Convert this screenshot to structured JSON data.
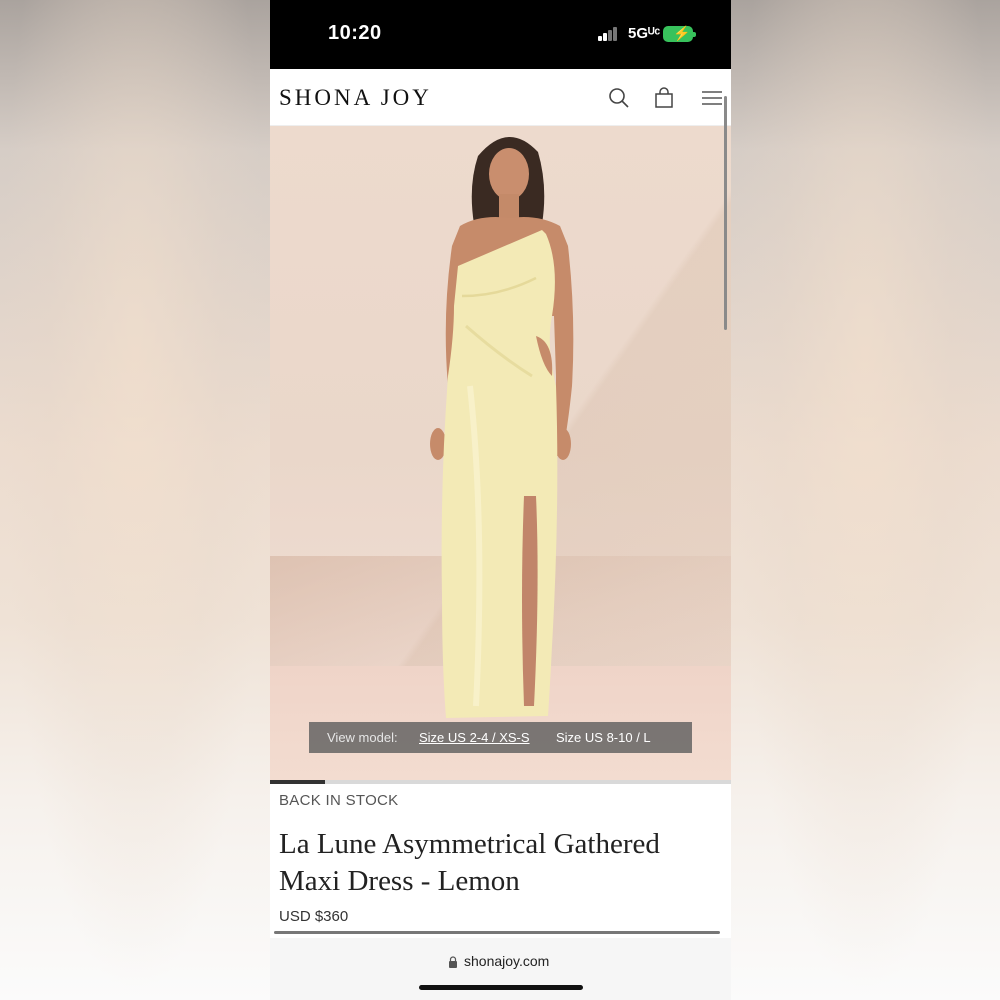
{
  "status_bar": {
    "time": "10:20",
    "network": "5Gᵁᶜ",
    "battery_state": "charging",
    "accent_color": "#38c25c"
  },
  "header": {
    "brand": "SHONA JOY",
    "icons": [
      "search-icon",
      "bag-icon",
      "menu-icon"
    ]
  },
  "product_image": {
    "view_model_label": "View model:",
    "sizes": [
      "Size US 2-4 / XS-S",
      "Size US 8-10 / L"
    ],
    "selected_size_index": 0,
    "carousel_progress": 0.12
  },
  "product": {
    "stock_status": "BACK IN STOCK",
    "title": "La Lune Asymmetrical Gathered Maxi Dress - Lemon",
    "price": "USD $360",
    "dress_color": "#f3eab6"
  },
  "browser": {
    "url": "shonajoy.com"
  }
}
